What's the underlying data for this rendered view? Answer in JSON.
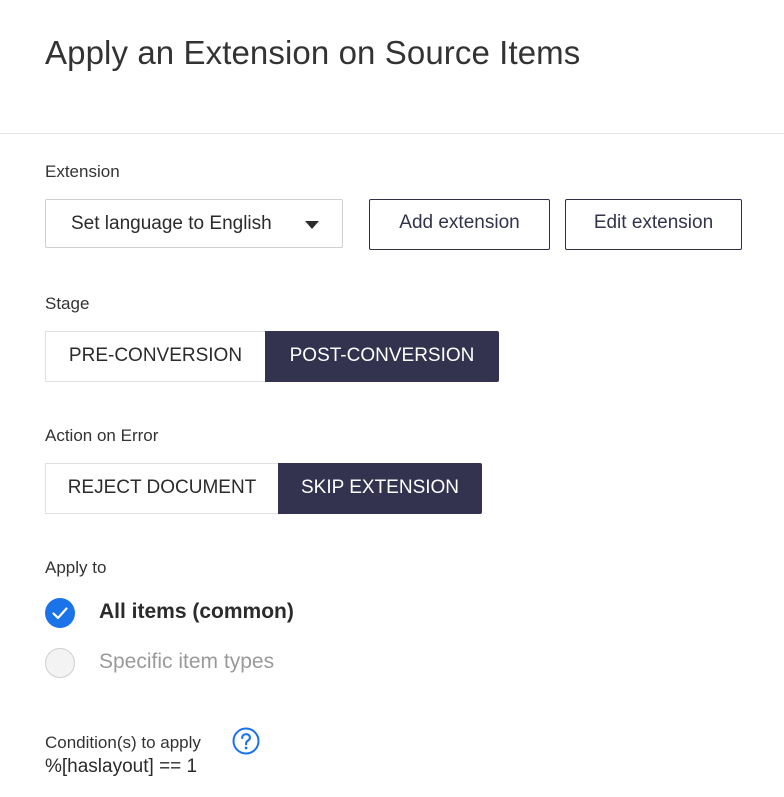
{
  "dialog": {
    "title": "Apply an Extension on Source Items"
  },
  "extension": {
    "label": "Extension",
    "selected": "Set language to English",
    "add_label": "Add extension",
    "edit_label": "Edit extension"
  },
  "stage": {
    "label": "Stage",
    "options": [
      "PRE-CONVERSION",
      "POST-CONVERSION"
    ],
    "selected": "POST-CONVERSION"
  },
  "action_on_error": {
    "label": "Action on Error",
    "options": [
      "REJECT DOCUMENT",
      "SKIP EXTENSION"
    ],
    "selected": "SKIP EXTENSION"
  },
  "apply_to": {
    "label": "Apply to",
    "options": [
      {
        "label": "All items (common)",
        "checked": true
      },
      {
        "label": "Specific item types",
        "checked": false
      }
    ]
  },
  "conditions": {
    "label": "Condition(s) to apply",
    "help_icon": "question-circle-icon",
    "value": "%[haslayout] == 1"
  },
  "colors": {
    "accent": "#1a73e8",
    "selected_segment": "#33334f",
    "divider": "#e3e3e3"
  }
}
